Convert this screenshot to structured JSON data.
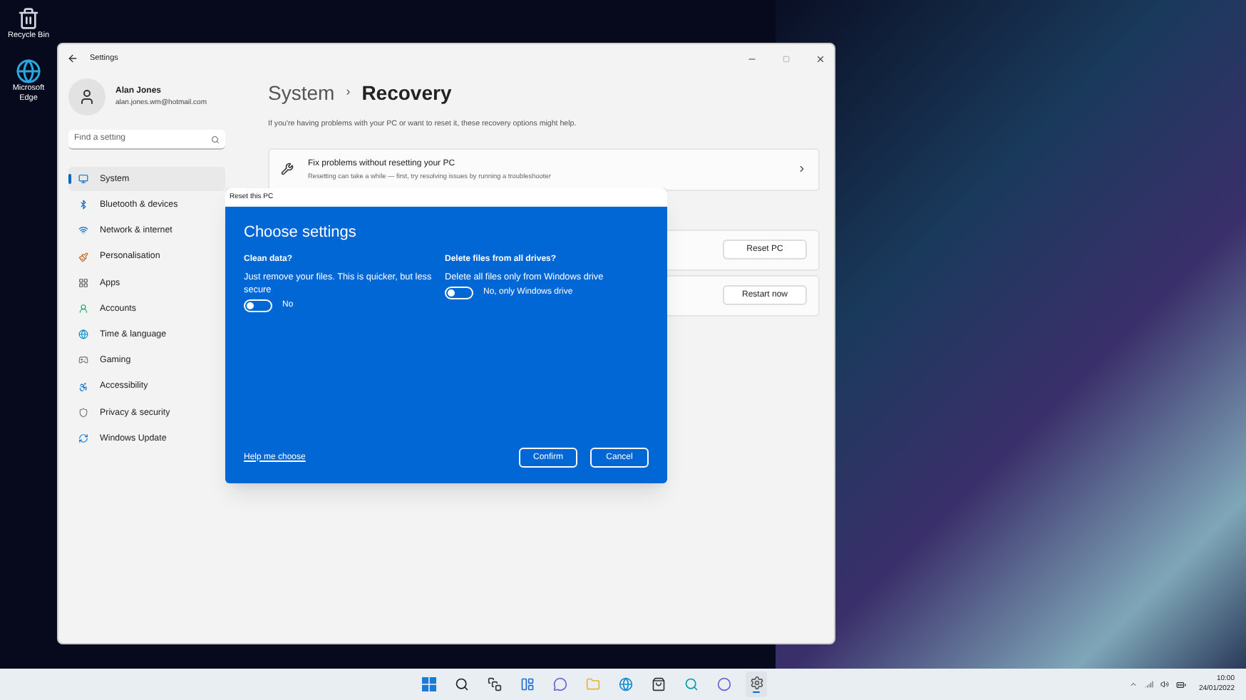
{
  "desktop_icons": [
    {
      "label": "Recycle Bin"
    },
    {
      "label": "Microsoft Edge"
    }
  ],
  "window": {
    "title": "Settings"
  },
  "profile": {
    "name": "Alan Jones",
    "email": "alan.jones.wm@hotmail.com"
  },
  "search": {
    "placeholder": "Find a setting"
  },
  "sidebar": {
    "items": [
      {
        "label": "System",
        "selected": true
      },
      {
        "label": "Bluetooth & devices",
        "selected": false
      },
      {
        "label": "Network & internet",
        "selected": false
      },
      {
        "label": "Personalisation",
        "selected": false
      },
      {
        "label": "Apps",
        "selected": false
      },
      {
        "label": "Accounts",
        "selected": false
      },
      {
        "label": "Time & language",
        "selected": false
      },
      {
        "label": "Gaming",
        "selected": false
      },
      {
        "label": "Accessibility",
        "selected": false
      },
      {
        "label": "Privacy & security",
        "selected": false
      },
      {
        "label": "Windows Update",
        "selected": false
      }
    ]
  },
  "breadcrumb": {
    "parent": "System",
    "separator": "›",
    "current": "Recovery"
  },
  "intro": "If you're having problems with your PC or want to reset it, these recovery options might help.",
  "fix_card": {
    "title": "Fix problems without resetting your PC",
    "subtitle": "Resetting can take a while — first, try resolving issues by running a troubleshooter"
  },
  "option_buttons": [
    "Reset PC",
    "Restart now"
  ],
  "dialog": {
    "title": "Reset this PC",
    "heading": "Choose settings",
    "options": [
      {
        "label": "Clean data?",
        "description": "Just remove your files. This is quicker, but less secure",
        "on": false,
        "state_text": "No"
      },
      {
        "label": "Delete files from all drives?",
        "description": "Delete all files only from Windows drive",
        "on": false,
        "state_text": "No, only Windows drive"
      }
    ],
    "link": "Help me choose",
    "buttons": [
      "Confirm",
      "Cancel"
    ]
  },
  "taskbar": {
    "apps": [
      {
        "active": false
      },
      {
        "active": false
      },
      {
        "active": false
      },
      {
        "active": false
      },
      {
        "active": false
      },
      {
        "active": false
      },
      {
        "active": false
      },
      {
        "active": false
      },
      {
        "active": false
      },
      {
        "active": false
      },
      {
        "active": true
      }
    ],
    "time": "10:00",
    "date": "24/01/2022"
  }
}
